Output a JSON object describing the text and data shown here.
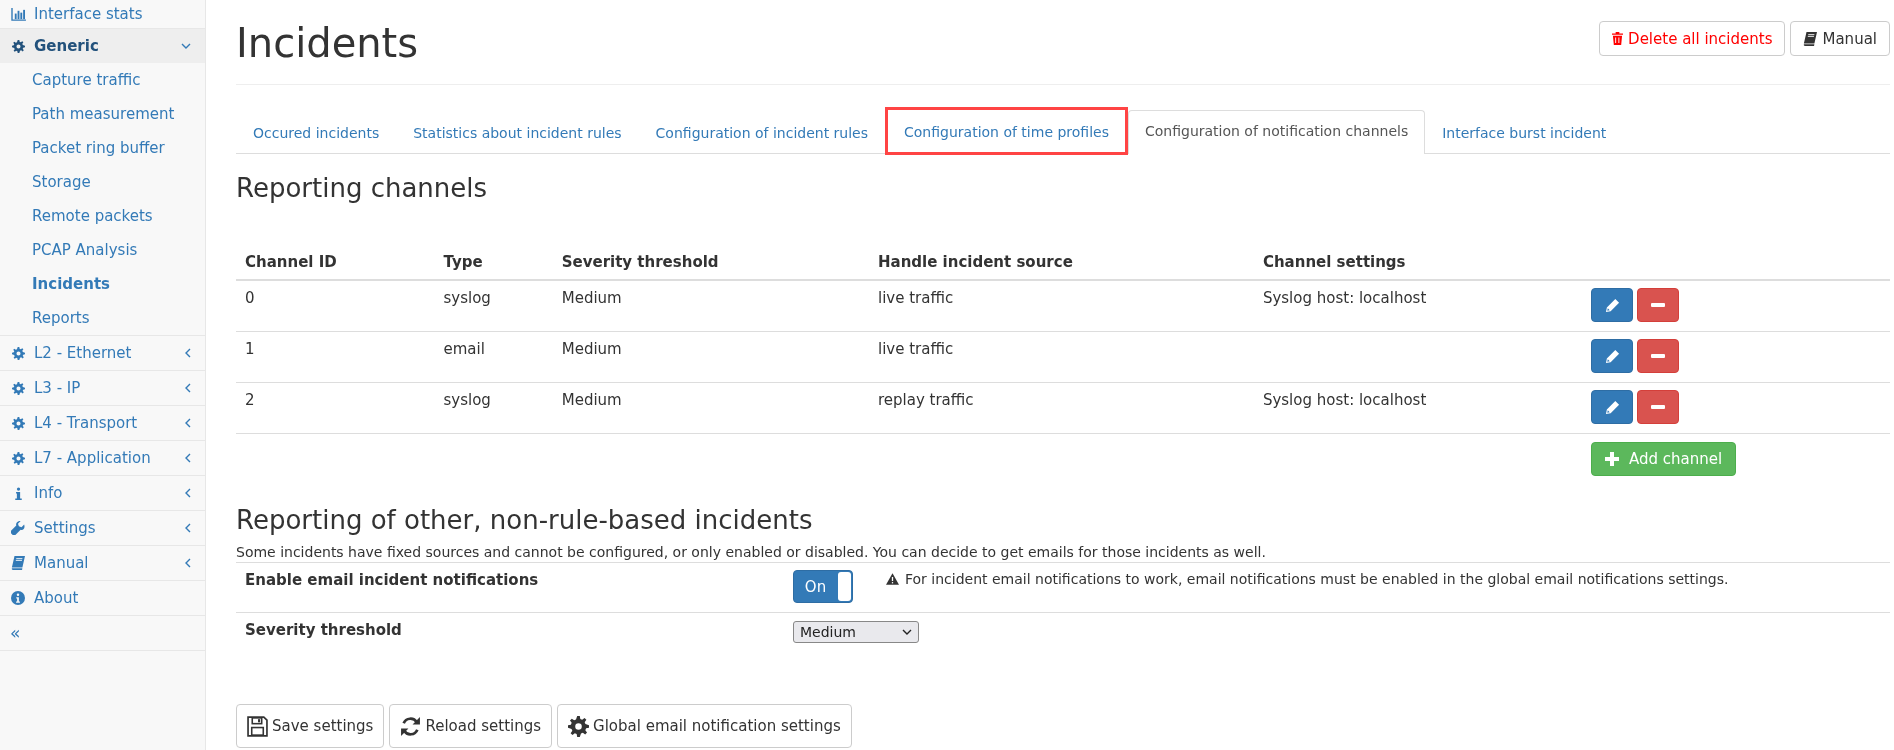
{
  "sidebar": {
    "items": [
      {
        "label": "Interface stats",
        "active": false
      },
      {
        "label": "Generic",
        "expanded": true,
        "active": true,
        "children": [
          {
            "label": "Capture traffic",
            "active": false
          },
          {
            "label": "Path measurement",
            "active": false
          },
          {
            "label": "Packet ring buffer",
            "active": false
          },
          {
            "label": "Storage",
            "active": false
          },
          {
            "label": "Remote packets",
            "active": false
          },
          {
            "label": "PCAP Analysis",
            "active": false
          },
          {
            "label": "Incidents",
            "active": true
          },
          {
            "label": "Reports",
            "active": false
          }
        ]
      },
      {
        "label": "L2 - Ethernet",
        "expanded": false,
        "active": false
      },
      {
        "label": "L3 - IP",
        "expanded": false,
        "active": false
      },
      {
        "label": "L4 - Transport",
        "expanded": false,
        "active": false
      },
      {
        "label": "L7 - Application",
        "expanded": false,
        "active": false
      },
      {
        "label": "Info",
        "expanded": false,
        "active": false
      },
      {
        "label": "Settings",
        "expanded": false,
        "active": false
      },
      {
        "label": "Manual",
        "expanded": false,
        "active": false
      },
      {
        "label": "About",
        "active": false
      }
    ],
    "collapse": "«"
  },
  "page": {
    "title": "Incidents",
    "actions": [
      {
        "label": "Delete all incidents",
        "kind": "danger"
      },
      {
        "label": "Manual",
        "kind": "default"
      }
    ]
  },
  "tabs": [
    {
      "label": "Occured incidents",
      "selected": false,
      "highlighted": false
    },
    {
      "label": "Statistics about incident rules",
      "selected": false,
      "highlighted": false
    },
    {
      "label": "Configuration of incident rules",
      "selected": false,
      "highlighted": false
    },
    {
      "label": "Configuration of time profiles",
      "selected": false,
      "highlighted": true
    },
    {
      "label": "Configuration of notification channels",
      "selected": true,
      "highlighted": false
    },
    {
      "label": "Interface burst incident",
      "selected": false,
      "highlighted": false
    }
  ],
  "channels": {
    "heading": "Reporting channels",
    "columns": [
      "Channel ID",
      "Type",
      "Severity threshold",
      "Handle incident source",
      "Channel settings"
    ],
    "rows": [
      [
        "0",
        "syslog",
        "Medium",
        "live traffic",
        "Syslog host: localhost"
      ],
      [
        "1",
        "email",
        "Medium",
        "live traffic",
        ""
      ],
      [
        "2",
        "syslog",
        "Medium",
        "replay traffic",
        "Syslog host: localhost"
      ]
    ],
    "add_button": "Add channel"
  },
  "other": {
    "heading": "Reporting of other, non-rule-based incidents",
    "description": "Some incidents have fixed sources and cannot be configured, or only enabled or disabled. You can decide to get emails for those incidents as well.",
    "settings": [
      {
        "kind": "toggle",
        "label": "Enable email incident notifications",
        "value": "On",
        "on": true,
        "note": "For incident email notifications to work, email notifications must be enabled in the global email notifications settings."
      },
      {
        "kind": "select",
        "label": "Severity threshold",
        "value": "Medium"
      }
    ]
  },
  "footer_buttons": [
    {
      "label": "Save settings",
      "kind": "save"
    },
    {
      "label": "Reload settings",
      "kind": "reload"
    },
    {
      "label": "Global email notification settings",
      "kind": "gear"
    }
  ]
}
